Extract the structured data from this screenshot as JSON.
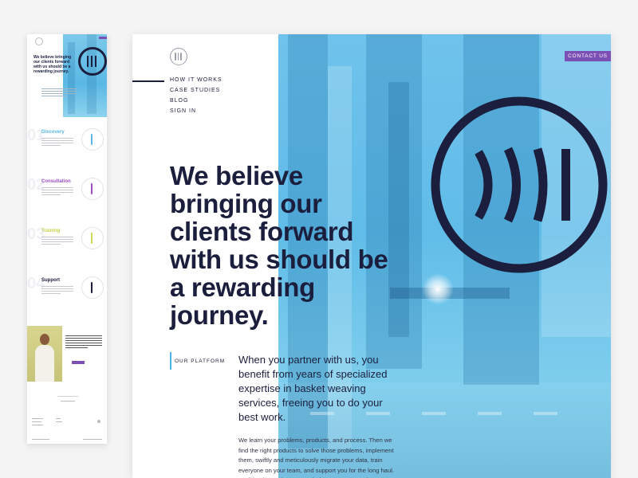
{
  "thumbnail": {
    "headline": "We believe bringing our clients forward with us should be a rewarding journey.",
    "steps": [
      {
        "number": "01",
        "title": "Discovery",
        "color": "#5ab8e4"
      },
      {
        "number": "02",
        "title": "Consultation",
        "color": "#9b4fc3"
      },
      {
        "number": "03",
        "title": "Training",
        "color": "#cdd94e"
      },
      {
        "number": "04",
        "title": "Support",
        "color": "#1b1e3c"
      }
    ]
  },
  "header": {
    "logo_icon": "brand-mark-icon",
    "contact_label": "CONTACT US"
  },
  "nav": {
    "items": [
      {
        "label": "HOW IT WORKS",
        "active": true
      },
      {
        "label": "CASE STUDIES",
        "active": false
      },
      {
        "label": "BLOG",
        "active": false
      },
      {
        "label": "SIGN IN",
        "active": false
      }
    ]
  },
  "hero": {
    "headline": "We believe bringing our clients forward with us should be a rewarding journey.",
    "brand_icon": "brand-circle-icon"
  },
  "platform": {
    "label": "OUR PLATFORM",
    "lead": "When you partner with us, you benefit from years of specialized expertise in basket weaving services, freeing you to do your best work.",
    "body": "We learn your problems, products, and process. Then we find the right products to solve those problems, implement them, swiftly and meticulously migrate your data, train everyone on your team, and support you for the long haul. We'll be there wherever and whenever you need us."
  },
  "colors": {
    "navy": "#1b1e3c",
    "sky": "#60bce8",
    "purple": "#7c4fb4",
    "lime": "#cdd94e"
  }
}
